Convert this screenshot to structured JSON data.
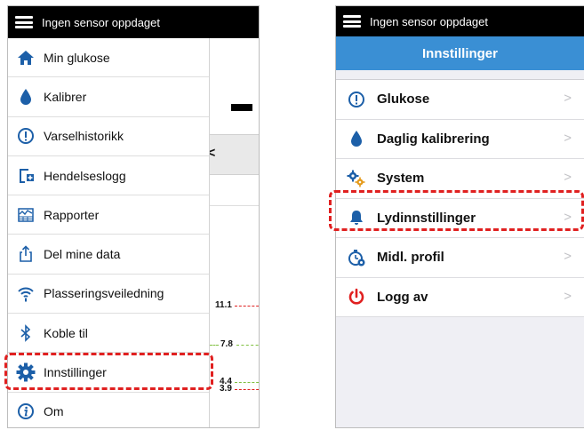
{
  "left_screen": {
    "header": {
      "title": "Ingen sensor oppdaget",
      "menu_icon": "hamburger-icon"
    },
    "menu": [
      {
        "label": "Min glukose",
        "icon": "home-icon"
      },
      {
        "label": "Kalibrer",
        "icon": "drop-icon"
      },
      {
        "label": "Varselhistorikk",
        "icon": "alert-circle-icon"
      },
      {
        "label": "Hendelseslogg",
        "icon": "add-log-icon"
      },
      {
        "label": "Rapporter",
        "icon": "report-icon"
      },
      {
        "label": "Del mine data",
        "icon": "share-icon"
      },
      {
        "label": "Plasseringsveiledning",
        "icon": "wireless-icon"
      },
      {
        "label": "Koble til",
        "icon": "bluetooth-icon"
      },
      {
        "label": "Innstillinger",
        "icon": "gear-icon",
        "highlighted": true
      },
      {
        "label": "Om",
        "icon": "info-icon"
      }
    ],
    "background": {
      "back_chevron": "<",
      "threshold_values": [
        "11.1",
        "7.8",
        "4.4",
        "3.9"
      ]
    }
  },
  "right_screen": {
    "header": {
      "title": "Ingen sensor oppdaget",
      "menu_icon": "hamburger-icon"
    },
    "nav_title": "Innstillinger",
    "settings": [
      {
        "label": "Glukose",
        "icon": "alert-circle-icon"
      },
      {
        "label": "Daglig kalibrering",
        "icon": "drop-icon"
      },
      {
        "label": "System",
        "icon": "gears-icon"
      },
      {
        "label": "Lydinnstillinger",
        "icon": "bell-icon",
        "highlighted": true
      },
      {
        "label": "Midl. profil",
        "icon": "timer-profile-icon"
      },
      {
        "label": "Logg av",
        "icon": "power-icon"
      }
    ],
    "chevron": ">"
  },
  "colors": {
    "header_bg": "#000000",
    "nav_blue": "#3a8fd4",
    "icon_blue": "#1c5fa8",
    "highlight_red": "#e02020",
    "logout_red": "#e02020",
    "threshold_red": "#e02020",
    "threshold_green": "#7fbf3f"
  }
}
